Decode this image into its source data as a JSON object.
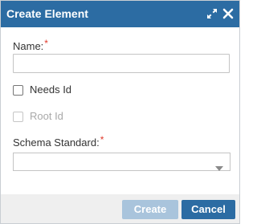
{
  "dialog": {
    "title": "Create Element",
    "maximize_icon": "expand-arrows-icon",
    "close_icon": "close-icon"
  },
  "form": {
    "name_label": "Name:",
    "required_marker": "*",
    "name_value": "",
    "needs_id_label": "Needs Id",
    "needs_id_checked": false,
    "root_id_label": "Root Id",
    "root_id_checked": false,
    "root_id_disabled": true,
    "schema_label": "Schema Standard:",
    "schema_value": ""
  },
  "footer": {
    "create_label": "Create",
    "create_disabled": true,
    "cancel_label": "Cancel"
  },
  "colors": {
    "accent": "#2c6ca3",
    "accent_disabled": "#a9c4dc",
    "required": "#e0392b"
  }
}
